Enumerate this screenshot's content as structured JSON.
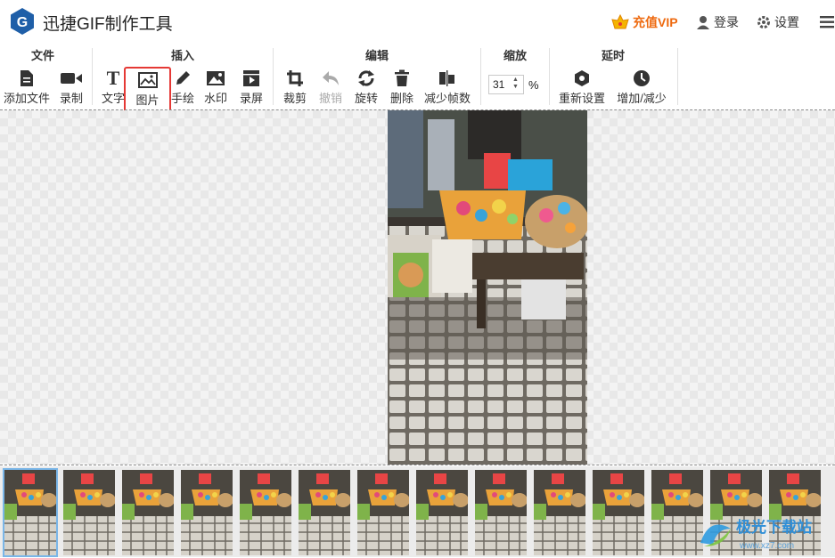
{
  "app": {
    "title": "迅捷GIF制作工具",
    "logo_letter": "G"
  },
  "header": {
    "vip_label": "充值VIP",
    "login_label": "登录",
    "settings_label": "设置"
  },
  "groups": [
    {
      "title": "文件"
    },
    {
      "title": "插入"
    },
    {
      "title": "编辑"
    },
    {
      "title": "缩放"
    },
    {
      "title": "延时"
    }
  ],
  "tools": {
    "add_file": "添加文件",
    "record": "录制",
    "text": "文字",
    "image": "图片",
    "draw": "手绘",
    "watermark": "水印",
    "screen_record": "录屏",
    "crop": "裁剪",
    "undo": "撤销",
    "rotate": "旋转",
    "delete": "删除",
    "reduce_frames": "减少帧数",
    "zoom_value": "31",
    "zoom_unit": "%",
    "reset": "重新设置",
    "increase_decrease": "增加/减少"
  },
  "colors": {
    "accent": "#1f5fa8",
    "vip": "#ee6a10",
    "selection": "#e53935"
  },
  "watermark": {
    "text": "极光下载站",
    "url": "www.xz7.com"
  },
  "frames_count": 14
}
